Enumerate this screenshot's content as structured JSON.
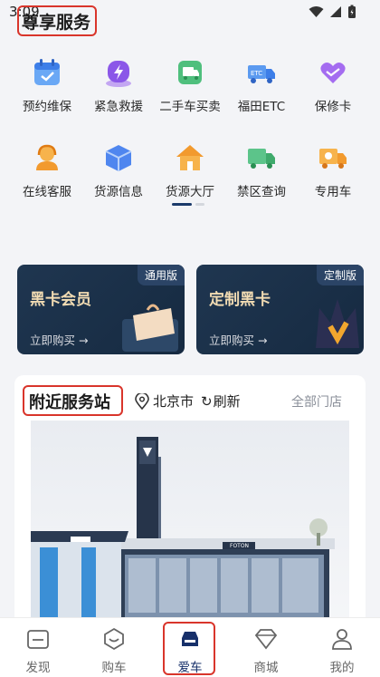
{
  "status_bar": {
    "time": "3:09"
  },
  "section": {
    "title": "尊享服务"
  },
  "services": [
    {
      "label": "预约维保",
      "icon": "calendar-icon"
    },
    {
      "label": "紧急救援",
      "icon": "lightning-icon"
    },
    {
      "label": "二手车买卖",
      "icon": "used-car-truck-icon"
    },
    {
      "label": "福田ETC",
      "icon": "etc-truck-icon"
    },
    {
      "label": "保修卡",
      "icon": "handshake-icon"
    },
    {
      "label": "在线客服",
      "icon": "support-agent-icon"
    },
    {
      "label": "货源信息",
      "icon": "box-icon"
    },
    {
      "label": "货源大厅",
      "icon": "house-icon"
    },
    {
      "label": "禁区查询",
      "icon": "green-truck-icon"
    },
    {
      "label": "专用车",
      "icon": "special-truck-icon"
    }
  ],
  "cards": [
    {
      "tag": "通用版",
      "title": "黑卡会员",
      "buy": "立即购买 →"
    },
    {
      "tag": "定制版",
      "title": "定制黑卡",
      "buy": "立即购买 →"
    }
  ],
  "nearby": {
    "title": "附近服务站",
    "city": "北京市",
    "refresh": "刷新",
    "all_stores": "全部门店",
    "brand_text": "FOTON"
  },
  "tabbar": [
    {
      "label": "发现",
      "icon": "discover-icon"
    },
    {
      "label": "购车",
      "icon": "buy-car-icon"
    },
    {
      "label": "爱车",
      "icon": "my-car-icon"
    },
    {
      "label": "商城",
      "icon": "diamond-icon"
    },
    {
      "label": "我的",
      "icon": "person-icon"
    }
  ],
  "colors": {
    "accent": "#17306a",
    "highlight_box": "#d9352b",
    "gold_text": "#f2dcb3"
  }
}
